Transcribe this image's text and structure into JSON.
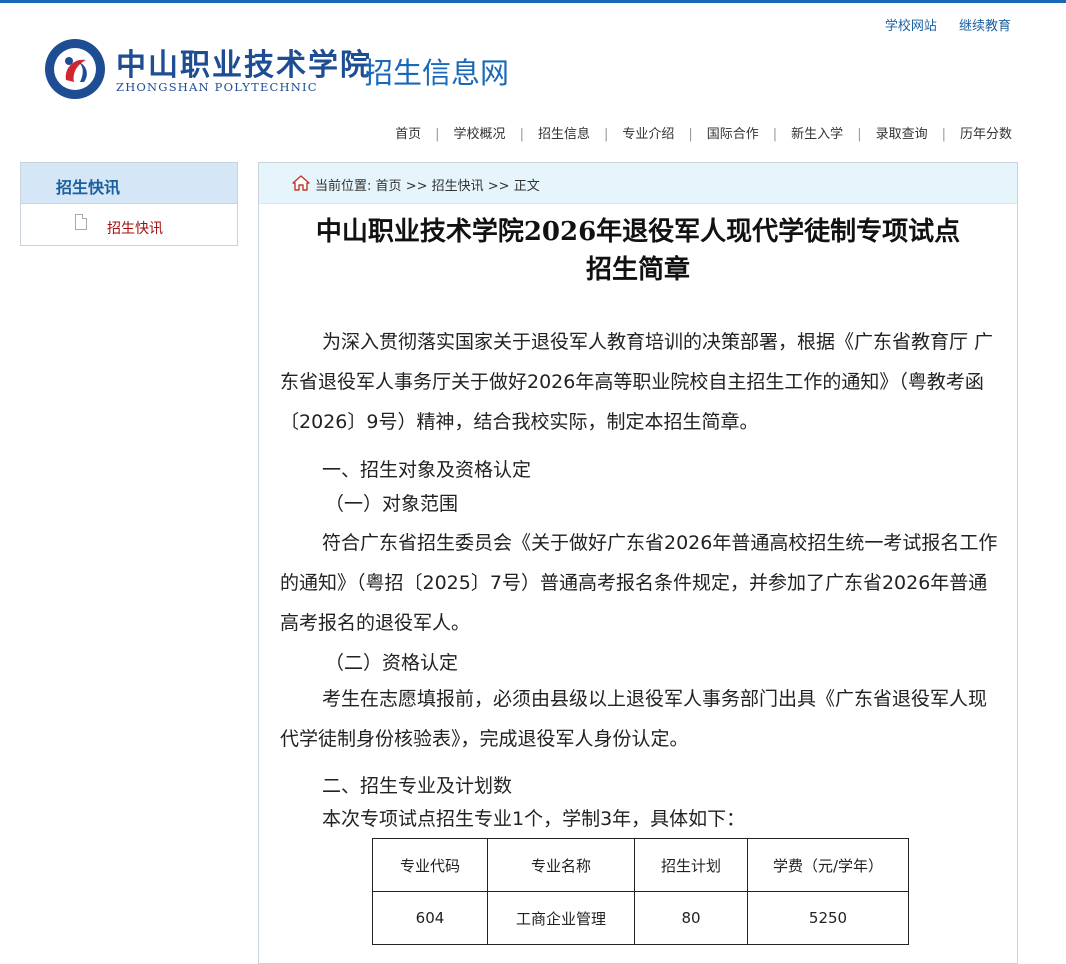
{
  "top_links": [
    "学校网站",
    "继续教育"
  ],
  "brand": {
    "name_cn": "中山职业技术学院",
    "name_en": "ZHONGSHAN POLYTECHNIC",
    "site_name": "招生信息网"
  },
  "nav": [
    "首页",
    "学校概况",
    "招生信息",
    "专业介绍",
    "国际合作",
    "新生入学",
    "录取查询",
    "历年分数"
  ],
  "sidebar": {
    "title": "招生快讯",
    "items": [
      "招生快讯"
    ]
  },
  "breadcrumb": {
    "prefix": "当前位置:",
    "items": [
      "首页",
      "招生快讯",
      "正文"
    ],
    "separator": ">>"
  },
  "article": {
    "title_line1": "中山职业技术学院2026年退役军人现代学徒制专项试点",
    "title_line2": "招生简章",
    "intro": "为深入贯彻落实国家关于退役军人教育培训的决策部署，根据《广东省教育厅 广东省退役军人事务厅关于做好2026年高等职业院校自主招生工作的通知》（粤教考函〔2026〕9号）精神，结合我校实际，制定本招生简章。",
    "section1": "一、招生对象及资格认定",
    "sub1": "（一）对象范围",
    "sub1_text": "符合广东省招生委员会《关于做好广东省2026年普通高校招生统一考试报名工作的通知》（粤招〔2025〕7号）普通高考报名条件规定，并参加了广东省2026年普通高考报名的退役军人。",
    "sub2": "（二）资格认定",
    "sub2_text": "考生在志愿填报前，必须由县级以上退役军人事务部门出具《广东省退役军人现代学徒制身份核验表》，完成退役军人身份认定。",
    "section2": "二、招生专业及计划数",
    "plan_intro": "本次专项试点招生专业1个，学制3年，具体如下："
  },
  "plan_table": {
    "headers": [
      "专业代码",
      "专业名称",
      "招生计划",
      "学费（元/学年）"
    ],
    "rows": [
      [
        "604",
        "工商企业管理",
        "80",
        "5250"
      ]
    ]
  },
  "colors": {
    "brand_blue": "#1a68b8",
    "sidebar_active": "#a50f0f",
    "breadcrumb_bg": "#e6f4fb"
  }
}
